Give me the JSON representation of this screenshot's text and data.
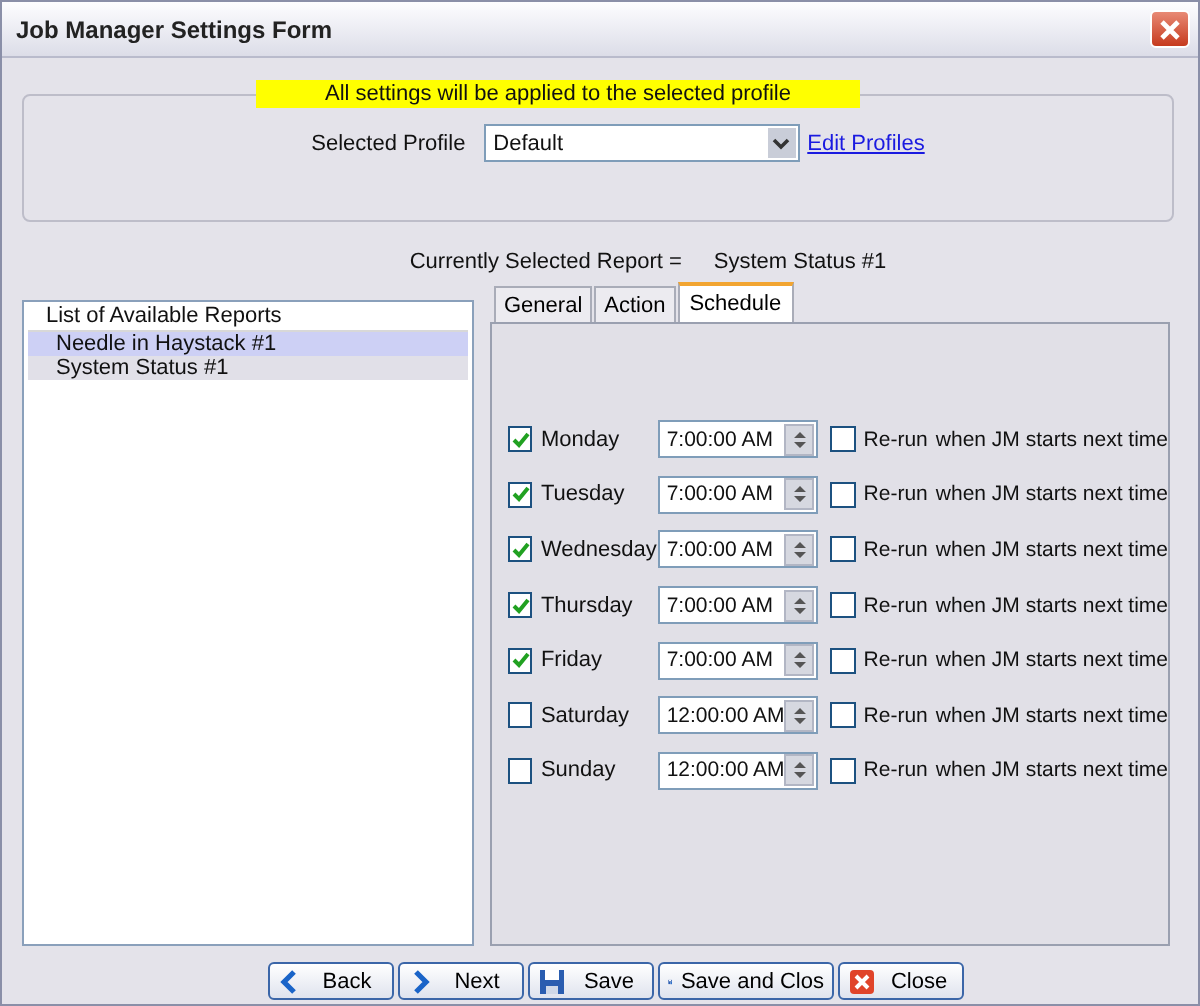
{
  "window": {
    "title": "Job Manager Settings Form"
  },
  "banner": "All settings will be applied to the selected profile",
  "profile": {
    "label": "Selected Profile",
    "value": "Default",
    "link": "Edit Profiles"
  },
  "current_report": {
    "label": "Currently Selected Report =",
    "value": "System Status #1"
  },
  "reports": {
    "header": "List of Available Reports",
    "items": [
      {
        "label": "Needle in Haystack #1",
        "selected": true
      },
      {
        "label": "System Status #1",
        "selected": false
      }
    ]
  },
  "tabs": [
    {
      "label": "General",
      "selected": false
    },
    {
      "label": "Action",
      "selected": false
    },
    {
      "label": "Schedule",
      "selected": true
    }
  ],
  "schedule": [
    {
      "day": "Monday",
      "checked": true,
      "time": "7:00:00 AM",
      "rerun_checked": false,
      "rerun_label": "Re-run",
      "rerun_text": "when JM starts next time"
    },
    {
      "day": "Tuesday",
      "checked": true,
      "time": "7:00:00 AM",
      "rerun_checked": false,
      "rerun_label": "Re-run",
      "rerun_text": "when JM starts next time"
    },
    {
      "day": "Wednesday",
      "checked": true,
      "time": "7:00:00 AM",
      "rerun_checked": false,
      "rerun_label": "Re-run",
      "rerun_text": "when JM starts next time"
    },
    {
      "day": "Thursday",
      "checked": true,
      "time": "7:00:00 AM",
      "rerun_checked": false,
      "rerun_label": "Re-run",
      "rerun_text": "when JM starts next time"
    },
    {
      "day": "Friday",
      "checked": true,
      "time": "7:00:00 AM",
      "rerun_checked": false,
      "rerun_label": "Re-run",
      "rerun_text": "when JM starts next time"
    },
    {
      "day": "Saturday",
      "checked": false,
      "time": "12:00:00 AM",
      "rerun_checked": false,
      "rerun_label": "Re-run",
      "rerun_text": "when JM starts next time"
    },
    {
      "day": "Sunday",
      "checked": false,
      "time": "12:00:00 AM",
      "rerun_checked": false,
      "rerun_label": "Re-run",
      "rerun_text": "when JM starts next time"
    }
  ],
  "buttons": [
    {
      "label": "Back",
      "kind": "back"
    },
    {
      "label": "Next",
      "kind": "next"
    },
    {
      "label": "Save",
      "kind": "save"
    },
    {
      "label": "Save and Clos",
      "kind": "saveclose"
    },
    {
      "label": "Close",
      "kind": "close"
    }
  ]
}
